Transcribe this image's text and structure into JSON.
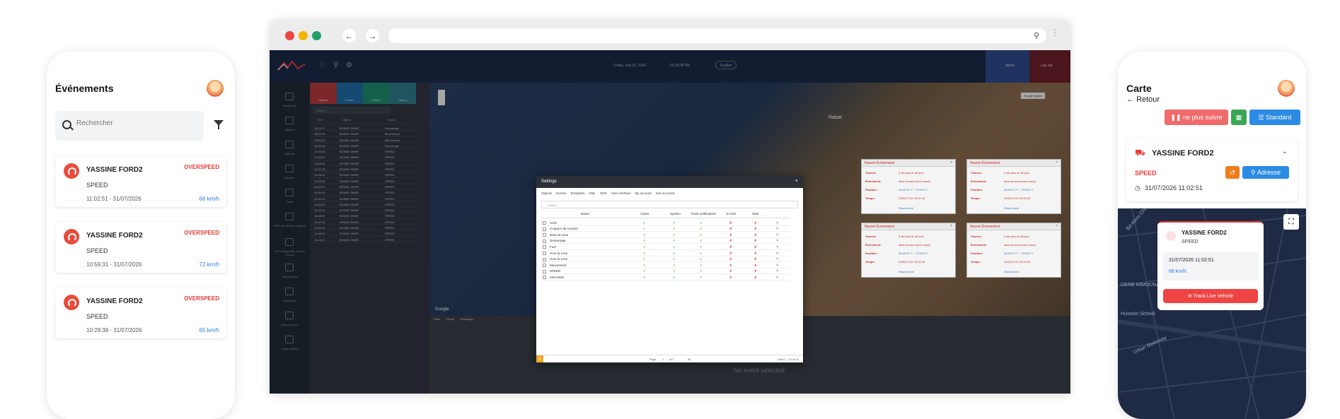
{
  "left_phone": {
    "title": "Événements",
    "search_placeholder": "Rechercher",
    "events": [
      {
        "name": "YASSINE FORD2",
        "type": "OVERSPEED",
        "sub": "SPEED",
        "time": "11:02:51 - 31/07/2026",
        "speed": "66 km/h"
      },
      {
        "name": "YASSINE FORD2",
        "type": "OVERSPEED",
        "sub": "SPEED",
        "time": "10:59:31 - 31/07/2026",
        "speed": "72 km/h"
      },
      {
        "name": "YASSINE FORD2",
        "type": "OVERSPEED",
        "sub": "SPEED",
        "time": "10:29:38 - 31/07/2026",
        "speed": "65 km/h"
      }
    ]
  },
  "right_phone": {
    "title": "Carte",
    "back_label": "Retour",
    "stop_follow_label": "ne plus suivre",
    "standard_label": "Standard",
    "vehicle_name": "YASSINE FORD2",
    "status": "SPEED",
    "datetime": "31/07/2026 11:02:51",
    "address_label": "Adresse",
    "map_labels": {
      "label1": "Bd Abou Chouaib",
      "label2": "DERB MIMOUNA",
      "label3": "Hussein School",
      "label4": "Urban Motorway"
    },
    "popup": {
      "name": "YASSINE FORD2",
      "sub": "SPEED",
      "datetime": "31/07/2026 11:02:51",
      "speed": "66 km/h",
      "track_label": "Track Live Vehicle"
    }
  },
  "browser": {
    "topbar": {
      "date": "Friday, July 31, 2026",
      "time": "03:28:38 PM",
      "lang": "English",
      "user": "demo",
      "logout": "Log out"
    },
    "sidebar": [
      "Dashboard",
      "Objects",
      "Settings",
      "Reports",
      "Tasks",
      "RFID and iButton logbook",
      "DTC (Diagnostic Trouble Codes)",
      "Maintenance",
      "Expenses",
      "Object control",
      "Image gallery"
    ],
    "panel_tabs": [
      "Objects",
      "Events",
      "Places",
      "History"
    ],
    "panel_search": "Search",
    "panel_headers": [
      "Time",
      "Object",
      "Event"
    ],
    "panel_rows": [
      [
        "15:02:17",
        "BOWIE ONWR",
        "Demarrage"
      ],
      [
        "15:02:00",
        "BOWIE ONWR",
        "Mouvement"
      ],
      [
        "15:01:45",
        "BOWIE ONWR",
        "Mouvement"
      ],
      [
        "15:00:55",
        "BOWIE ONWR",
        "Demarrage"
      ],
      [
        "14:59:50",
        "BOWIE ONWR",
        "SPEED"
      ],
      [
        "14:59:09",
        "BOWIE ONWR",
        "SPEED"
      ],
      [
        "14:58:31",
        "BOWIE ONWR",
        "SPEED"
      ],
      [
        "14:57:44",
        "BOWIE ONWR",
        "SPEED"
      ],
      [
        "14:56:12",
        "BOWIE ONWR",
        "SPEED"
      ],
      [
        "14:55:30",
        "BOWIE ONWR",
        "SPEED"
      ],
      [
        "14:54:02",
        "BOWIE ONWR",
        "SPEED"
      ],
      [
        "14:52:41",
        "BOWIE ONWR",
        "SPEED"
      ],
      [
        "14:51:09",
        "BOWIE ONWR",
        "SPEED"
      ],
      [
        "14:50:33",
        "BOWIE ONWR",
        "SPEED"
      ],
      [
        "14:49:18",
        "BOWIE ONWR",
        "SPEED"
      ],
      [
        "14:48:02",
        "BOWIE ONWR",
        "SPEED"
      ],
      [
        "14:47:25",
        "BOWIE ONWR",
        "SPEED"
      ],
      [
        "14:46:10",
        "BOWIE ONWR",
        "SPEED"
      ],
      [
        "14:45:00",
        "BOWIE ONWR",
        "SPEED"
      ],
      [
        "14:44:21",
        "BOWIE ONWR",
        "SPEED"
      ]
    ],
    "map_city": "Rabat",
    "map_type_label": "Google Hybrid",
    "google_label": "Google",
    "notif": {
      "title": "Nouvel Événement",
      "k1": "Traceur:",
      "v1": "3 dél plus le dél pos",
      "k2": "Événement:",
      "v2": "dans la zone (zone casa)",
      "k3": "Position:",
      "v3": "33.6179 ?? - 7.5763 ??",
      "k4": "Temps:",
      "v4": "2026-07-02 16:10:43",
      "link": "Show event"
    },
    "bottom_tabs": [
      "Data",
      "Graph",
      "Messages"
    ],
    "no_event": "No event selected",
    "settings": {
      "title": "Settings",
      "tabs": [
        "Objects",
        "Events",
        "Templates",
        "KML",
        "SMS",
        "User interface",
        "My account",
        "Sub accounts"
      ],
      "search": "Search",
      "headers": [
        "Name",
        "Active",
        "System",
        "Push notifications",
        "E-mail",
        "SMS"
      ],
      "rows": [
        "Arrêt",
        "Coupure de courant",
        "Dans la zone",
        "Demarrage",
        "Fuel",
        "Hors la zone",
        "Hors la zone",
        "Mouvement",
        "SPEED",
        "VIDANGE"
      ],
      "page_label": "Page",
      "page": "1",
      "of": "of 1",
      "per_page": "50",
      "view_label": "View 1 - 10 of 10"
    }
  },
  "colors": {
    "danger": "#e53935",
    "primary": "#2c7be5",
    "success": "#2ea043",
    "panel": "#2e3640"
  }
}
